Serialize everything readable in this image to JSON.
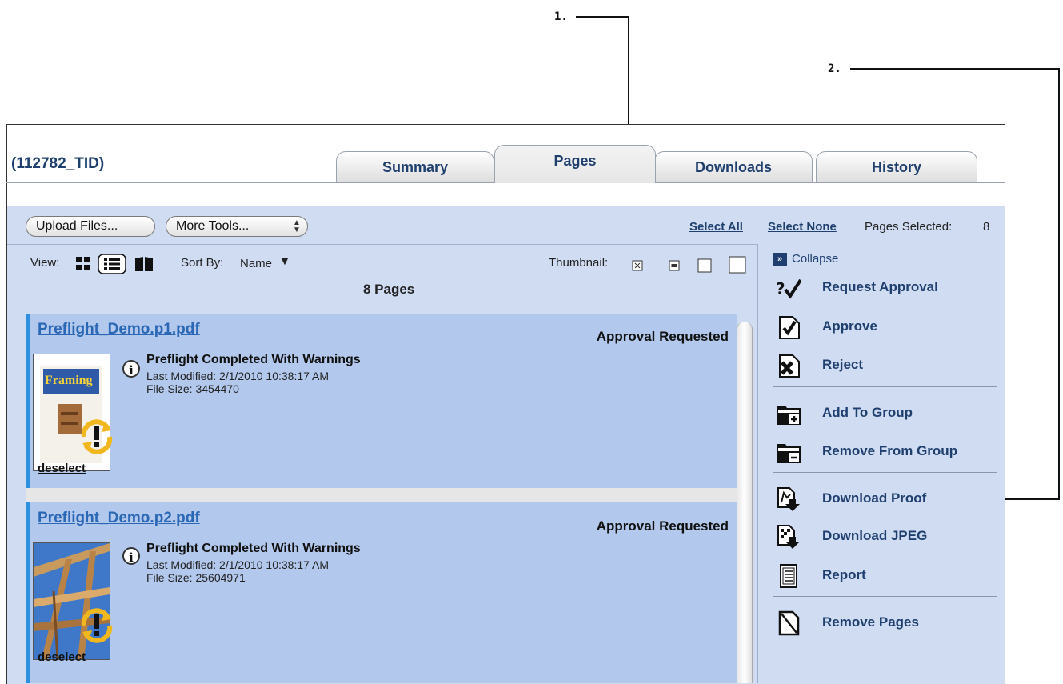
{
  "callouts": {
    "one": "1.",
    "two": "2."
  },
  "job_title": "(112782_TID)",
  "tabs": [
    {
      "label": "Summary"
    },
    {
      "label": "Pages"
    },
    {
      "label": "Downloads"
    },
    {
      "label": "History"
    }
  ],
  "toolbar": {
    "upload_label": "Upload Files...",
    "more_tools_label": "More Tools...",
    "select_all": "Select All",
    "select_none": "Select None",
    "pages_selected_label": "Pages Selected:",
    "pages_selected_count": "8"
  },
  "view": {
    "view_label": "View:",
    "sort_label": "Sort By:",
    "sort_value": "Name",
    "thumbnail_label": "Thumbnail:",
    "page_count": "8 Pages"
  },
  "pages": [
    {
      "filename": "Preflight_Demo.p1.pdf",
      "status": "Approval Requested",
      "preflight": "Preflight Completed With Warnings",
      "modified": "Last Modified: 2/1/2010 10:38:17 AM",
      "size": "File Size: 3454470",
      "deselect": "deselect",
      "thumb_text": "Framing"
    },
    {
      "filename": "Preflight_Demo.p2.pdf",
      "status": "Approval Requested",
      "preflight": "Preflight Completed With Warnings",
      "modified": "Last Modified: 2/1/2010 10:38:17 AM",
      "size": "File Size: 25604971",
      "deselect": "deselect"
    }
  ],
  "actions": {
    "collapse": "Collapse",
    "request_approval": "Request Approval",
    "approve": "Approve",
    "reject": "Reject",
    "add_to_group": "Add To Group",
    "remove_from_group": "Remove From Group",
    "download_proof": "Download Proof",
    "download_jpeg": "Download JPEG",
    "report": "Report",
    "remove_pages": "Remove Pages"
  },
  "colors": {
    "panel_bg": "#cfdcf2",
    "row_bg": "#b2c8ec",
    "row_accent": "#2d8fe0",
    "link_blue": "#2a67b5",
    "title_blue": "#1f3f6e"
  }
}
